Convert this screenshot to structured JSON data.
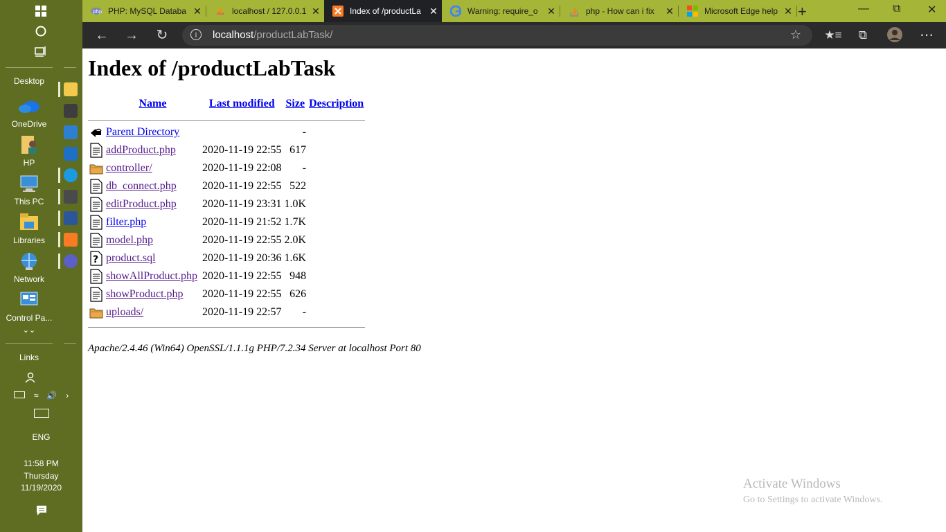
{
  "taskbar": {
    "desktop_label": "Desktop",
    "desktop_items": [
      {
        "label": "OneDrive",
        "icon": "onedrive-icon"
      },
      {
        "label": "HP",
        "icon": "user-folder-icon"
      },
      {
        "label": "This PC",
        "icon": "this-pc-icon"
      },
      {
        "label": "Libraries",
        "icon": "libraries-icon"
      },
      {
        "label": "Network",
        "icon": "network-icon"
      },
      {
        "label": "Control Pa...",
        "icon": "control-panel-icon"
      }
    ],
    "links_label": "Links",
    "language": "ENG",
    "time": "11:58 PM",
    "day": "Thursday",
    "date": "11/19/2020"
  },
  "browser": {
    "tabs": [
      {
        "title": "PHP: MySQL Databa",
        "icon": "php-icon"
      },
      {
        "title": "localhost / 127.0.0.1",
        "icon": "phpmyadmin-icon"
      },
      {
        "title": "Index of /productLa",
        "icon": "xampp-icon",
        "active": true
      },
      {
        "title": "Warning: require_o",
        "icon": "google-icon"
      },
      {
        "title": "php - How can i fix",
        "icon": "stackoverflow-icon"
      },
      {
        "title": "Microsoft Edge help",
        "icon": "microsoft-icon"
      }
    ],
    "address": {
      "host": "localhost",
      "path": "/productLabTask/"
    }
  },
  "page": {
    "title": "Index of /productLabTask",
    "columns": {
      "name": "Name",
      "modified": "Last modified",
      "size": "Size",
      "description": "Description"
    },
    "rows": [
      {
        "name": "Parent Directory",
        "modified": "",
        "size": "-",
        "type": "back",
        "visited": false
      },
      {
        "name": "addProduct.php",
        "modified": "2020-11-19 22:55",
        "size": "617",
        "type": "text",
        "visited": true
      },
      {
        "name": "controller/",
        "modified": "2020-11-19 22:08",
        "size": "-",
        "type": "folder",
        "visited": true
      },
      {
        "name": "db_connect.php",
        "modified": "2020-11-19 22:55",
        "size": "522",
        "type": "text",
        "visited": true
      },
      {
        "name": "editProduct.php",
        "modified": "2020-11-19 23:31",
        "size": "1.0K",
        "type": "text",
        "visited": true
      },
      {
        "name": "filter.php",
        "modified": "2020-11-19 21:52",
        "size": "1.7K",
        "type": "text",
        "visited": false
      },
      {
        "name": "model.php",
        "modified": "2020-11-19 22:55",
        "size": "2.0K",
        "type": "text",
        "visited": true
      },
      {
        "name": "product.sql",
        "modified": "2020-11-19 20:36",
        "size": "1.6K",
        "type": "unknown",
        "visited": true
      },
      {
        "name": "showAllProduct.php",
        "modified": "2020-11-19 22:55",
        "size": "948",
        "type": "text",
        "visited": true
      },
      {
        "name": "showProduct.php",
        "modified": "2020-11-19 22:55",
        "size": "626",
        "type": "text",
        "visited": true
      },
      {
        "name": "uploads/",
        "modified": "2020-11-19 22:57",
        "size": "-",
        "type": "folder",
        "visited": true
      }
    ],
    "footer": "Apache/2.4.46 (Win64) OpenSSL/1.1.1g PHP/7.2.34 Server at localhost Port 80"
  },
  "watermark": {
    "line1": "Activate Windows",
    "line2": "Go to Settings to activate Windows."
  }
}
